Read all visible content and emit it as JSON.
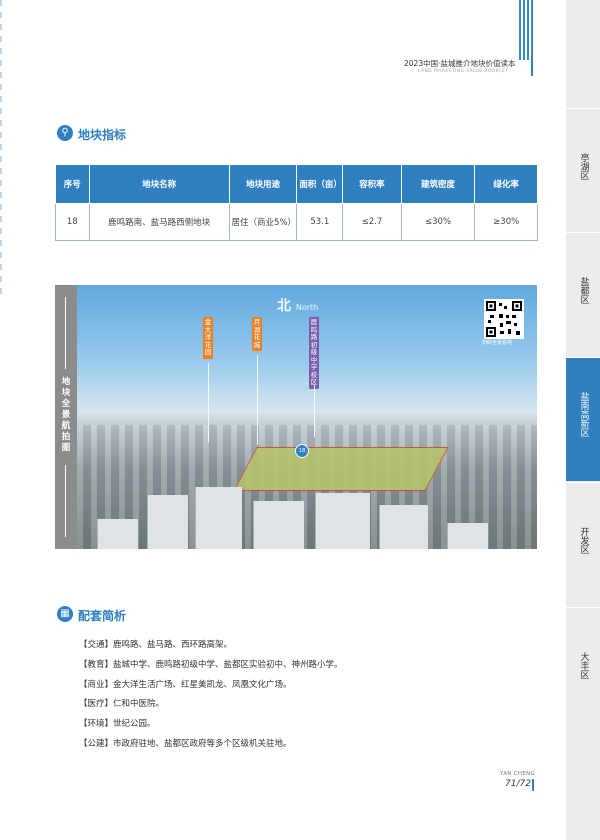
{
  "header": {
    "title": "2023中国·盐城推介地块价值读本",
    "subtitle": "LAND MARKETING VALUE BOOKLET"
  },
  "section_index": {
    "title": "地块指标",
    "icon": "location-pin-icon"
  },
  "table": {
    "headers": [
      "序号",
      "地块名称",
      "地块用途",
      "面积（亩）",
      "容积率",
      "建筑密度",
      "绿化率"
    ],
    "rows": [
      [
        "18",
        "鹿鸣路南、盐马路西侧地块",
        "居住（商业5%）",
        "53.1",
        "≤2.7",
        "≤30%",
        "≥30%"
      ]
    ]
  },
  "photo": {
    "side_label": "地块全景航拍图",
    "north_label": "北",
    "north_en": "North",
    "qr_caption": "扫码全景看地",
    "plot_number": "18",
    "tags": [
      {
        "text": "金大洋花园",
        "color": "#e8832a"
      },
      {
        "text": "月湖花城",
        "color": "#e8832a"
      },
      {
        "text": "鹿鸣路初级中学校区",
        "color": "#7a5fae"
      }
    ]
  },
  "section_support": {
    "title": "配套简析",
    "icon": "building-icon"
  },
  "amenities": [
    "【交通】鹿鸣路、盐马路、西环路高架。",
    "【教育】盐城中学、鹿鸣路初级中学、盐都区实验初中、神州路小学。",
    "【商业】金大洋生活广场、红星美凯龙、凤凰文化广场。",
    "【医疗】仁和中医院。",
    "【环境】世纪公园。",
    "【公建】市政府驻地、盐都区政府等多个区级机关驻地。"
  ],
  "footer": {
    "city_en": "YAN CHENG",
    "page": "71/72"
  },
  "nav": [
    {
      "label": "亭湖区",
      "active": false
    },
    {
      "label": "盐都区",
      "active": false
    },
    {
      "label": "盐南高新区",
      "active": true
    },
    {
      "label": "开发区",
      "active": false
    },
    {
      "label": "大丰区",
      "active": false
    }
  ],
  "colors": {
    "accent": "#2f7fc1",
    "tag_orange": "#e8832a",
    "tag_purple": "#7a5fae"
  }
}
